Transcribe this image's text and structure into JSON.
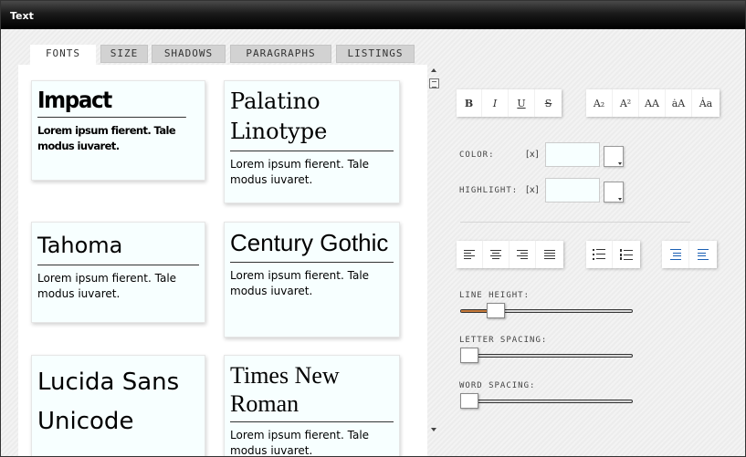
{
  "window": {
    "title": "Text"
  },
  "tabs": [
    {
      "label": "FONTS",
      "active": true
    },
    {
      "label": "SIZE",
      "active": false
    },
    {
      "label": "SHADOWS",
      "active": false
    },
    {
      "label": "PARAGRAPHS",
      "active": false
    },
    {
      "label": "LISTINGS",
      "active": false
    }
  ],
  "fonts": [
    {
      "name": "Impact",
      "sample": "Lorem ipsum fierent. Tale modus iuvaret."
    },
    {
      "name": "Palatino Linotype",
      "sample": "Lorem ipsum fierent. Tale modus iuvaret."
    },
    {
      "name": "Tahoma",
      "sample": "Lorem ipsum fierent. Tale modus iuvaret."
    },
    {
      "name": "Century Gothic",
      "sample": "Lorem ipsum fierent. Tale modus iuvaret."
    },
    {
      "name": "Lucida Sans Unicode",
      "sample": ""
    },
    {
      "name": "Times New Roman",
      "sample": "Lorem ipsum fierent. Tale modus iuvaret."
    }
  ],
  "style_buttons": [
    {
      "label": "B",
      "icon": "bold-icon"
    },
    {
      "label": "I",
      "icon": "italic-icon"
    },
    {
      "label": "U",
      "icon": "underline-icon"
    },
    {
      "label": "S",
      "icon": "strikethrough-icon"
    }
  ],
  "case_buttons": [
    {
      "label": "A₂",
      "icon": "subscript-icon"
    },
    {
      "label": "A²",
      "icon": "superscript-icon"
    },
    {
      "label": "AA",
      "icon": "uppercase-icon"
    },
    {
      "label": "ȧA",
      "icon": "small-caps-icon"
    },
    {
      "label": "Ȧa",
      "icon": "capitalize-icon"
    }
  ],
  "color": {
    "label": "COLOR:",
    "clear": "[x]",
    "value": ""
  },
  "highlight": {
    "label": "HIGHLIGHT:",
    "clear": "[x]",
    "value": ""
  },
  "align_buttons": [
    "align-left-icon",
    "align-center-icon",
    "align-right-icon",
    "align-justify-icon"
  ],
  "list_buttons": [
    "bullet-list-icon",
    "numbered-list-icon"
  ],
  "indent_buttons": [
    "indent-icon",
    "outdent-icon"
  ],
  "sliders": [
    {
      "label": "LINE HEIGHT:",
      "value": 0.17
    },
    {
      "label": "LETTER SPACING:",
      "value": 0.0
    },
    {
      "label": "WORD SPACING:",
      "value": 0.0
    }
  ],
  "colors": {
    "accent": "#c77a3a",
    "card_bg": "#f7ffff",
    "titlebar": "#000000"
  }
}
